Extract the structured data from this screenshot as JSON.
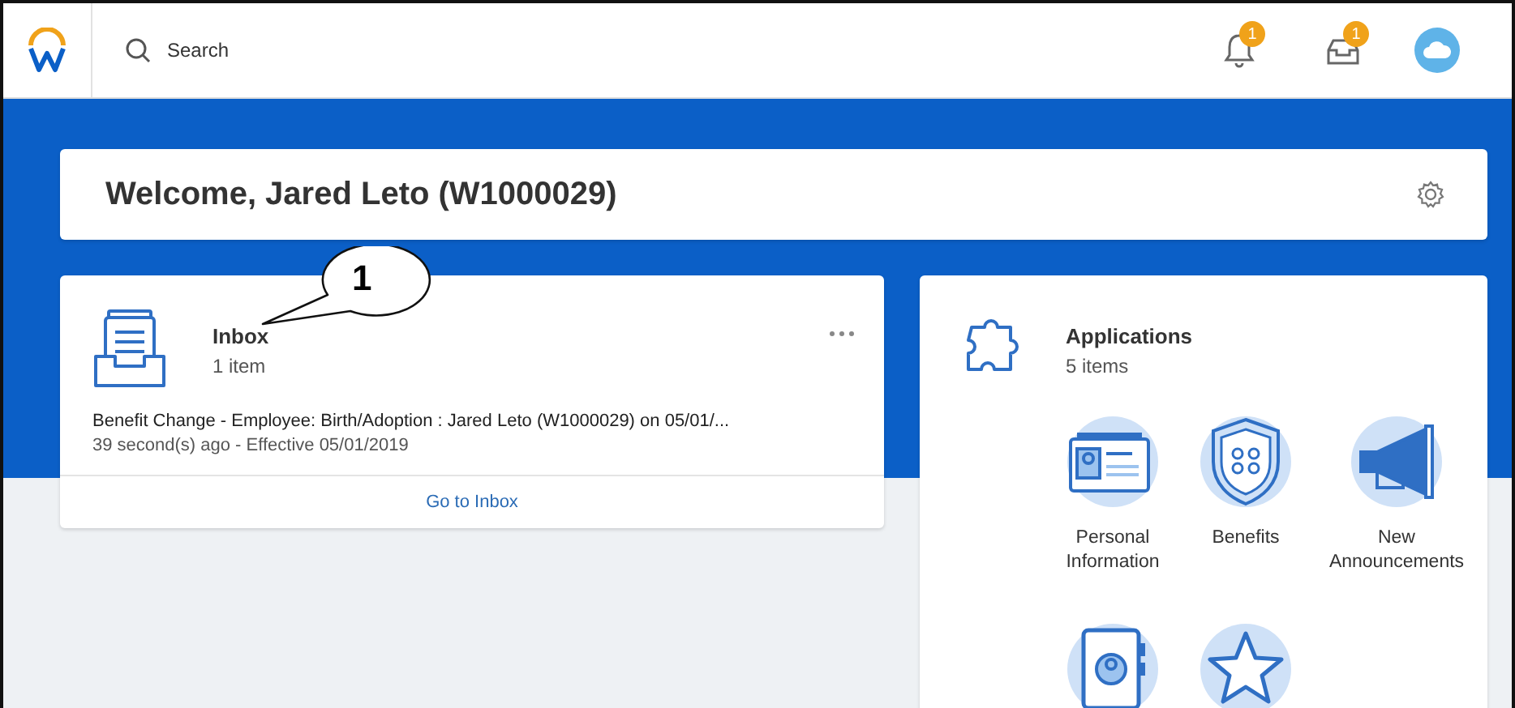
{
  "top_bar": {
    "search": {
      "placeholder": "Search"
    },
    "notifications": {
      "badge": "1"
    },
    "inbox": {
      "badge": "1"
    }
  },
  "welcome": {
    "title": "Welcome, Jared Leto (W1000029)"
  },
  "inbox_card": {
    "title": "Inbox",
    "count": "1 item",
    "items": [
      {
        "title": "Benefit Change - Employee: Birth/Adoption : Jared Leto  (W1000029) on 05/01/...",
        "subtitle": "39 second(s) ago - Effective 05/01/2019"
      }
    ],
    "link": "Go to Inbox"
  },
  "applications_card": {
    "title": "Applications",
    "count": "5 items",
    "apps": [
      {
        "kind": "id-card",
        "label": "Personal Information"
      },
      {
        "kind": "shield",
        "label": "Benefits"
      },
      {
        "kind": "megaphone",
        "label": "New Announcements"
      },
      {
        "kind": "contact-book"
      },
      {
        "kind": "star"
      }
    ]
  },
  "callout": {
    "number": "1"
  }
}
